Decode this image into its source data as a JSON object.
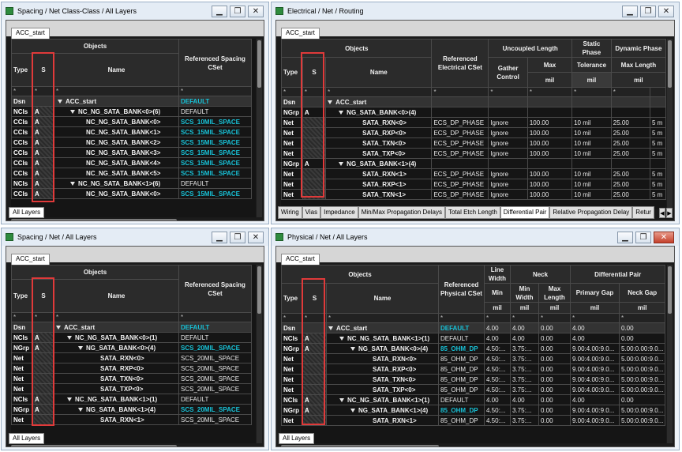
{
  "common": {
    "context_tab": "ACC_start",
    "bottom_tab": "All Layers",
    "minimize": "▁",
    "maximize": "❐",
    "close": "✕",
    "filter": "*",
    "root_type": "Dsn",
    "root_name": "ACC_start"
  },
  "w1": {
    "title": "Spacing / Net Class-Class / All Layers",
    "col_objects": "Objects",
    "col_type": "Type",
    "col_s": "S",
    "col_name": "Name",
    "col_ref": "Referenced Spacing CSet",
    "root_ref": "DEFAULT",
    "rows": [
      {
        "type": "NCIs",
        "s": "A",
        "name": "NC_NG_SATA_BANK<0>(6)",
        "ref": "DEFAULT"
      },
      {
        "type": "CCIs",
        "s": "A",
        "name": "NC_NG_SATA_BANK<0>",
        "ref": "SCS_10MIL_SPACE"
      },
      {
        "type": "CCIs",
        "s": "A",
        "name": "NC_NG_SATA_BANK<1>",
        "ref": "SCS_15MIL_SPACE"
      },
      {
        "type": "CCIs",
        "s": "A",
        "name": "NC_NG_SATA_BANK<2>",
        "ref": "SCS_15MIL_SPACE"
      },
      {
        "type": "CCIs",
        "s": "A",
        "name": "NC_NG_SATA_BANK<3>",
        "ref": "SCS_15MIL_SPACE"
      },
      {
        "type": "CCIs",
        "s": "A",
        "name": "NC_NG_SATA_BANK<4>",
        "ref": "SCS_15MIL_SPACE"
      },
      {
        "type": "CCIs",
        "s": "A",
        "name": "NC_NG_SATA_BANK<5>",
        "ref": "SCS_15MIL_SPACE"
      },
      {
        "type": "NCIs",
        "s": "A",
        "name": "NC_NG_SATA_BANK<1>(6)",
        "ref": "DEFAULT"
      },
      {
        "type": "CCIs",
        "s": "A",
        "name": "NC_NG_SATA_BANK<0>",
        "ref": "SCS_15MIL_SPACE"
      }
    ]
  },
  "w2": {
    "title": "Electrical / Net / Routing",
    "col_objects": "Objects",
    "col_type": "Type",
    "col_s": "S",
    "col_name": "Name",
    "col_ref": "Referenced Electrical CSet",
    "col_uncoupled": "Uncoupled Length",
    "col_gather": "Gather Control",
    "col_max": "Max",
    "col_static": "Static Phase",
    "col_tolerance": "Tolerance",
    "col_dynamic": "Dynamic Phase",
    "col_maxlength": "Max Length",
    "unit": "mil",
    "rows": [
      {
        "type": "NGrp",
        "s": "A",
        "name": "NG_SATA_BANK<0>(4)",
        "ref": "",
        "gather": "",
        "max": "",
        "tol": "",
        "dyn": "",
        "extra": ""
      },
      {
        "type": "Net",
        "s": "",
        "name": "SATA_RXN<0>",
        "ref": "ECS_DP_PHASE",
        "gather": "Ignore",
        "max": "100.00",
        "tol": "10 mil",
        "dyn": "25.00",
        "extra": "5 m"
      },
      {
        "type": "Net",
        "s": "",
        "name": "SATA_RXP<0>",
        "ref": "ECS_DP_PHASE",
        "gather": "Ignore",
        "max": "100.00",
        "tol": "10 mil",
        "dyn": "25.00",
        "extra": "5 m"
      },
      {
        "type": "Net",
        "s": "",
        "name": "SATA_TXN<0>",
        "ref": "ECS_DP_PHASE",
        "gather": "Ignore",
        "max": "100.00",
        "tol": "10 mil",
        "dyn": "25.00",
        "extra": "5 m"
      },
      {
        "type": "Net",
        "s": "",
        "name": "SATA_TXP<0>",
        "ref": "ECS_DP_PHASE",
        "gather": "Ignore",
        "max": "100.00",
        "tol": "10 mil",
        "dyn": "25.00",
        "extra": "5 m"
      },
      {
        "type": "NGrp",
        "s": "A",
        "name": "NG_SATA_BANK<1>(4)",
        "ref": "",
        "gather": "",
        "max": "",
        "tol": "",
        "dyn": "",
        "extra": ""
      },
      {
        "type": "Net",
        "s": "",
        "name": "SATA_RXN<1>",
        "ref": "ECS_DP_PHASE",
        "gather": "Ignore",
        "max": "100.00",
        "tol": "10 mil",
        "dyn": "25.00",
        "extra": "5 m"
      },
      {
        "type": "Net",
        "s": "",
        "name": "SATA_RXP<1>",
        "ref": "ECS_DP_PHASE",
        "gather": "Ignore",
        "max": "100.00",
        "tol": "10 mil",
        "dyn": "25.00",
        "extra": "5 m"
      },
      {
        "type": "Net",
        "s": "",
        "name": "SATA_TXN<1>",
        "ref": "ECS_DP_PHASE",
        "gather": "Ignore",
        "max": "100.00",
        "tol": "10 mil",
        "dyn": "25.00",
        "extra": "5 m"
      }
    ],
    "tabs": [
      "Wiring",
      "Vias",
      "Impedance",
      "Min/Max Propagation Delays",
      "Total Etch Length",
      "Differential Pair",
      "Relative Propagation Delay",
      "Retur"
    ],
    "active_tab": 5
  },
  "w3": {
    "title": "Spacing / Net / All Layers",
    "col_objects": "Objects",
    "col_type": "Type",
    "col_s": "S",
    "col_name": "Name",
    "col_ref": "Referenced Spacing CSet",
    "root_ref": "DEFAULT",
    "rows": [
      {
        "type": "NCIs",
        "s": "A",
        "name": "NC_NG_SATA_BANK<0>(1)",
        "ref": "DEFAULT",
        "teal": false
      },
      {
        "type": "NGrp",
        "s": "A",
        "name": "NG_SATA_BANK<0>(4)",
        "ref": "SCS_20MIL_SPACE",
        "teal": true
      },
      {
        "type": "Net",
        "s": "",
        "name": "SATA_RXN<0>",
        "ref": "SCS_20MIL_SPACE",
        "teal": false
      },
      {
        "type": "Net",
        "s": "",
        "name": "SATA_RXP<0>",
        "ref": "SCS_20MIL_SPACE",
        "teal": false
      },
      {
        "type": "Net",
        "s": "",
        "name": "SATA_TXN<0>",
        "ref": "SCS_20MIL_SPACE",
        "teal": false
      },
      {
        "type": "Net",
        "s": "",
        "name": "SATA_TXP<0>",
        "ref": "SCS_20MIL_SPACE",
        "teal": false
      },
      {
        "type": "NCIs",
        "s": "A",
        "name": "NC_NG_SATA_BANK<1>(1)",
        "ref": "DEFAULT",
        "teal": false
      },
      {
        "type": "NGrp",
        "s": "A",
        "name": "NG_SATA_BANK<1>(4)",
        "ref": "SCS_20MIL_SPACE",
        "teal": true
      },
      {
        "type": "Net",
        "s": "",
        "name": "SATA_RXN<1>",
        "ref": "SCS_20MIL_SPACE",
        "teal": false
      }
    ]
  },
  "w4": {
    "title": "Physical / Net / All Layers",
    "col_objects": "Objects",
    "col_type": "Type",
    "col_s": "S",
    "col_name": "Name",
    "col_ref": "Referenced Physical CSet",
    "col_linewidth": "Line Width",
    "col_min": "Min",
    "col_neck": "Neck",
    "col_minwidth": "Min Width",
    "col_maxlength": "Max Length",
    "col_diffpair": "Differential Pair",
    "col_primarygap": "Primary Gap",
    "col_neckgap": "Neck Gap",
    "unit": "mil",
    "root": {
      "ref": "DEFAULT",
      "min": "4.00",
      "minw": "4.00",
      "maxl": "0.00",
      "pgap": "4.00",
      "ngap": "0.00"
    },
    "rows": [
      {
        "type": "NCIs",
        "s": "A",
        "name": "NC_NG_SATA_BANK<1>(1)",
        "ref": "DEFAULT",
        "teal": false,
        "min": "4.00",
        "minw": "4.00",
        "maxl": "0.00",
        "pgap": "4.00",
        "ngap": "0.00"
      },
      {
        "type": "NGrp",
        "s": "A",
        "name": "NG_SATA_BANK<0>(4)",
        "ref": "85_OHM_DP",
        "teal": true,
        "min": "4.50:...",
        "minw": "3.75:...",
        "maxl": "0.00",
        "pgap": "9.00:4.00:9.0...",
        "ngap": "5.00:0.00:9.0..."
      },
      {
        "type": "Net",
        "s": "",
        "name": "SATA_RXN<0>",
        "ref": "85_OHM_DP",
        "teal": false,
        "min": "4.50:...",
        "minw": "3.75:...",
        "maxl": "0.00",
        "pgap": "9.00:4.00:9.0...",
        "ngap": "5.00:0.00:9.0..."
      },
      {
        "type": "Net",
        "s": "",
        "name": "SATA_RXP<0>",
        "ref": "85_OHM_DP",
        "teal": false,
        "min": "4.50:...",
        "minw": "3.75:...",
        "maxl": "0.00",
        "pgap": "9.00:4.00:9.0...",
        "ngap": "5.00:0.00:9.0..."
      },
      {
        "type": "Net",
        "s": "",
        "name": "SATA_TXN<0>",
        "ref": "85_OHM_DP",
        "teal": false,
        "min": "4.50:...",
        "minw": "3.75:...",
        "maxl": "0.00",
        "pgap": "9.00:4.00:9.0...",
        "ngap": "5.00:0.00:9.0..."
      },
      {
        "type": "Net",
        "s": "",
        "name": "SATA_TXP<0>",
        "ref": "85_OHM_DP",
        "teal": false,
        "min": "4.50:...",
        "minw": "3.75:...",
        "maxl": "0.00",
        "pgap": "9.00:4.00:9.0...",
        "ngap": "5.00:0.00:9.0..."
      },
      {
        "type": "NCIs",
        "s": "A",
        "name": "NC_NG_SATA_BANK<1>(1)",
        "ref": "DEFAULT",
        "teal": false,
        "min": "4.00",
        "minw": "4.00",
        "maxl": "0.00",
        "pgap": "4.00",
        "ngap": "0.00"
      },
      {
        "type": "NGrp",
        "s": "A",
        "name": "NG_SATA_BANK<1>(4)",
        "ref": "85_OHM_DP",
        "teal": true,
        "min": "4.50:...",
        "minw": "3.75:...",
        "maxl": "0.00",
        "pgap": "9.00:4.00:9.0...",
        "ngap": "5.00:0.00:9.0..."
      },
      {
        "type": "Net",
        "s": "",
        "name": "SATA_RXN<1>",
        "ref": "85_OHM_DP",
        "teal": false,
        "min": "4.50:...",
        "minw": "3.75:...",
        "maxl": "0.00",
        "pgap": "9.00:4.00:9.0...",
        "ngap": "5.00:0.00:9.0..."
      }
    ]
  },
  "colors": {
    "accent_teal": "#18c1d6",
    "highlight_red": "#e03a3a"
  }
}
